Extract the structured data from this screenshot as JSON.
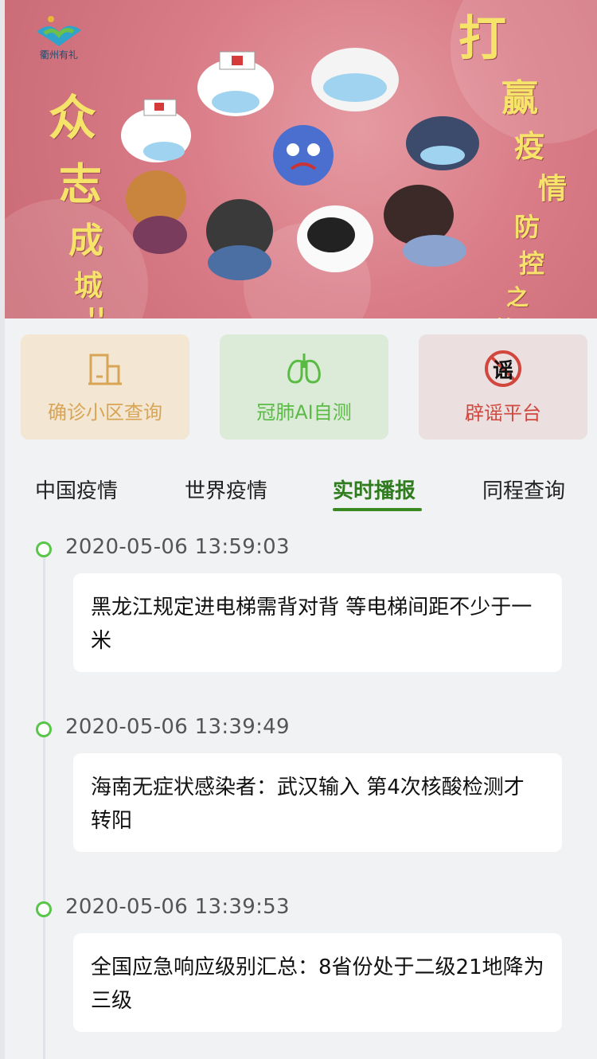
{
  "banner": {
    "logo_text": "衢州有礼",
    "slogan_left": [
      "众",
      "志",
      "成",
      "城",
      "!!"
    ],
    "slogan_right": [
      "打",
      "赢",
      "疫",
      "情",
      "防",
      "控",
      "之",
      "战",
      "!!"
    ]
  },
  "quick_actions": [
    {
      "label": "确诊小区查询",
      "icon": "building-icon",
      "color": "#d8a556"
    },
    {
      "label": "冠肺AI自测",
      "icon": "lungs-icon",
      "color": "#5abb44"
    },
    {
      "label": "辟谣平台",
      "icon": "no-rumor-icon",
      "color": "#d1473e",
      "icon_text": "谣"
    }
  ],
  "tabs": [
    {
      "label": "中国疫情",
      "active": false
    },
    {
      "label": "世界疫情",
      "active": false
    },
    {
      "label": "实时播报",
      "active": true
    },
    {
      "label": "同程查询",
      "active": false
    }
  ],
  "timeline": [
    {
      "time": "2020-05-06 13:59:03",
      "title": "黑龙江规定进电梯需背对背 等电梯间距不少于一米"
    },
    {
      "time": "2020-05-06 13:39:49",
      "title": "海南无症状感染者：武汉输入 第4次核酸检测才转阳"
    },
    {
      "time": "2020-05-06 13:39:53",
      "title": "全国应急响应级别汇总：8省份处于二级21地降为三级"
    }
  ]
}
